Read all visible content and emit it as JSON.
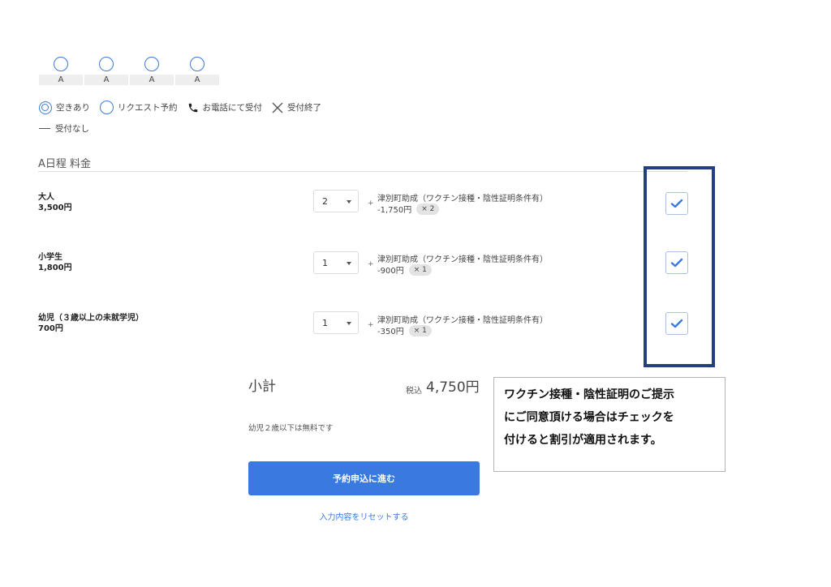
{
  "slots": [
    {
      "label": "A"
    },
    {
      "label": "A"
    },
    {
      "label": "A"
    },
    {
      "label": "A"
    }
  ],
  "legend": {
    "available": "空きあり",
    "request": "リクエスト予約",
    "phone": "お電話にて受付",
    "closed": "受付終了",
    "none": "受付なし"
  },
  "section": {
    "title": "A日程 料金"
  },
  "rows": [
    {
      "name": "大人",
      "price": "3,500円",
      "qty": "2",
      "subsidy_name": "津別町助成（ワクチン接種・陰性証明条件有）",
      "subsidy_price": "-1,750円",
      "multiplier": "× 2",
      "checked": true
    },
    {
      "name": "小学生",
      "price": "1,800円",
      "qty": "1",
      "subsidy_name": "津別町助成（ワクチン接種・陰性証明条件有）",
      "subsidy_price": "-900円",
      "multiplier": "× 1",
      "checked": true
    },
    {
      "name": "幼児（３歳以上の未就学児）",
      "price": "700円",
      "qty": "1",
      "subsidy_name": "津別町助成（ワクチン接種・陰性証明条件有）",
      "subsidy_price": "-350円",
      "multiplier": "× 1",
      "checked": true
    }
  ],
  "plus": "+",
  "summary": {
    "label": "小計",
    "tax_label": "税込",
    "total": "4,750円",
    "free_note": "幼児２歳以下は無料です"
  },
  "note": {
    "lines": [
      "ワクチン接種・陰性証明のご提示",
      "にご同意頂ける場合はチェックを",
      "付けると割引が適用されます。"
    ]
  },
  "actions": {
    "submit_label": "予約申込に進む",
    "reset_label": "入力内容をリセットする"
  },
  "colors": {
    "accent": "#3a79e0",
    "frame": "#22407f"
  }
}
